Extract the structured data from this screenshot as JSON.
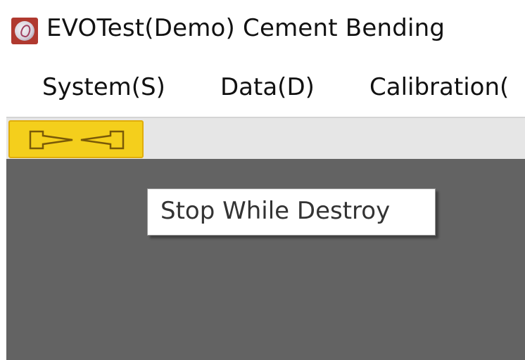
{
  "window": {
    "title": "EVOTest(Demo) Cement Bending",
    "icon": "app-logo-icon"
  },
  "menubar": {
    "items": [
      {
        "label": "System(S)"
      },
      {
        "label": "Data(D)"
      },
      {
        "label": "Calibration("
      }
    ]
  },
  "toolbar": {
    "buttons": [
      {
        "icon": "stop-while-destroy-icon",
        "tooltip": "Stop While Destroy"
      }
    ]
  },
  "colors": {
    "tool_button_bg": "#f4cf1c",
    "tool_button_border": "#e0ad0c",
    "workspace_bg": "#636363",
    "toolbar_bg": "#e6e6e6",
    "icon_bg": "#b0392f"
  }
}
